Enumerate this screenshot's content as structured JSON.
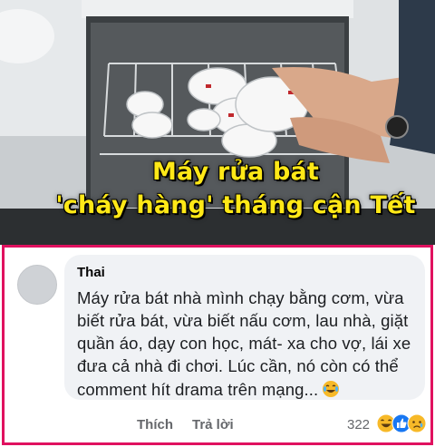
{
  "headline": {
    "line1": "Máy rửa bát",
    "line2": "'cháy hàng' tháng cận Tết",
    "color": "#ffe817"
  },
  "comment": {
    "author": "Thai",
    "lines": [
      "Máy rửa bát nhà mình chạy bằng cơm, vừa",
      "biết rửa bát, vừa biết nấu cơm, lau nhà, giặt",
      "quần áo, dạy con học, mát- xa cho vợ, lái xe",
      "đưa cả nhà đi chơi. Lúc cần, nó còn có thể",
      "comment hít drama trên mạng..."
    ],
    "inline_emoji": "laughing-tears-emoji",
    "like_label": "Thích",
    "reply_label": "Trả lời",
    "reaction_count": "322",
    "reactions": [
      "haha",
      "like",
      "sad"
    ]
  },
  "colors": {
    "border": "#e0115f",
    "bubble": "#f0f2f5",
    "like_blue": "#1877f2",
    "emoji_yellow": "#f7b928"
  }
}
